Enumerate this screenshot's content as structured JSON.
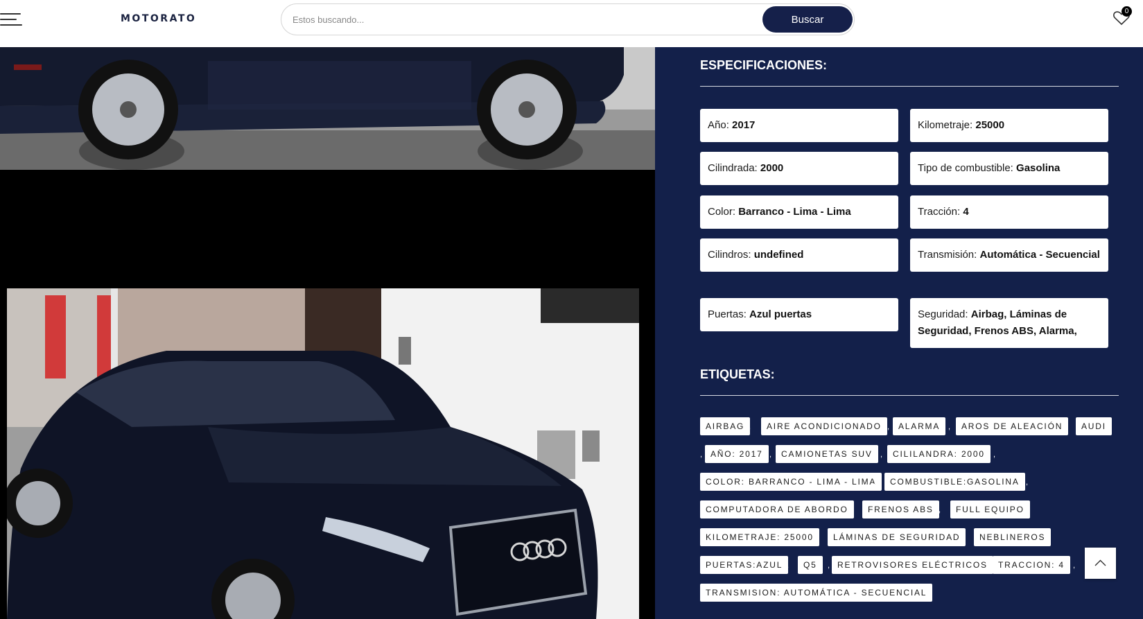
{
  "header": {
    "logo": "MOTORATO",
    "search_placeholder": "Estos buscando...",
    "search_button": "Buscar",
    "wishlist_count": "0"
  },
  "specs": {
    "title": "ESPECIFICACIONES:",
    "items": [
      {
        "label": "Año:",
        "value": "2017"
      },
      {
        "label": "Kilometraje:",
        "value": "25000"
      },
      {
        "label": "Cilindrada:",
        "value": "2000"
      },
      {
        "label": "Tipo de combustible:",
        "value": "Gasolina"
      },
      {
        "label": "Color:",
        "value": "Barranco - Lima - Lima"
      },
      {
        "label": "Tracción:",
        "value": "4"
      },
      {
        "label": "Cilindros:",
        "value": "undefined"
      },
      {
        "label": "Transmisión:",
        "value": "Automática - Secuencial"
      },
      {
        "label": "Puertas:",
        "value": "Azul puertas"
      },
      {
        "label": "Seguridad:",
        "value": "Airbag, Láminas de Seguridad, Frenos ABS, Alarma,"
      }
    ]
  },
  "tags": {
    "title": "ETIQUETAS:",
    "items": [
      "AIRBAG",
      "AIRE ACONDICIONADO",
      "ALARMA",
      "AROS DE ALEACIÓN",
      "AUDI",
      "AÑO: 2017",
      "CAMIONETAS SUV",
      "CILILANDRA: 2000",
      "COLOR: BARRANCO - LIMA - LIMA",
      "COMBUSTIBLE:GASOLINA",
      "COMPUTADORA DE ABORDO",
      "FRENOS ABS",
      "FULL EQUIPO",
      "KILOMETRAJE: 25000",
      "LÁMINAS DE SEGURIDAD",
      "NEBLINEROS",
      "PUERTAS:AZUL",
      "Q5",
      "RETROVISORES ELÉCTRICOS",
      "TRACCION: 4",
      "TRANSMISION: AUTOMÁTICA - SECUENCIAL"
    ]
  },
  "colors": {
    "panel": "#13204a",
    "button": "#15204a"
  }
}
